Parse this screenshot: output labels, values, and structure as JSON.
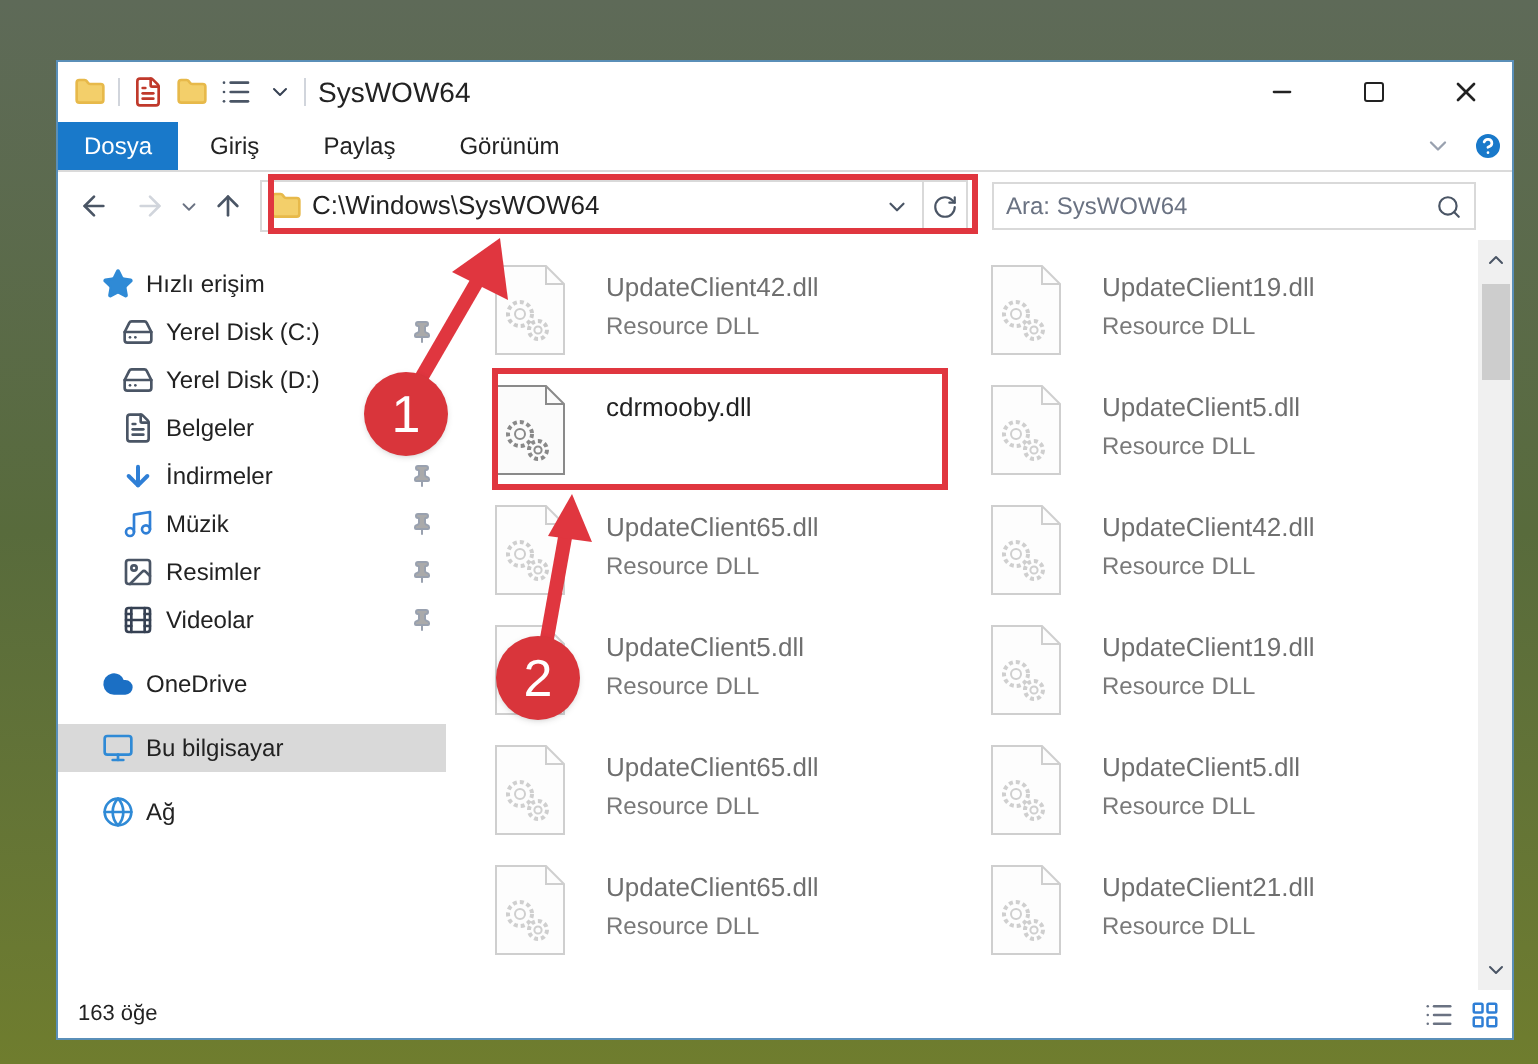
{
  "window": {
    "title": "SysWOW64"
  },
  "ribbon_tabs": [
    {
      "label": "Dosya",
      "selected": true
    },
    {
      "label": "Giriş",
      "selected": false
    },
    {
      "label": "Paylaş",
      "selected": false
    },
    {
      "label": "Görünüm",
      "selected": false
    }
  ],
  "address_bar": {
    "path": "C:\\Windows\\SysWOW64"
  },
  "search": {
    "placeholder": "Ara: SysWOW64"
  },
  "sidebar": {
    "items": [
      {
        "label": "Hızlı erişim",
        "selected": false,
        "children": [
          {
            "label": "Yerel Disk (C:)",
            "pinned": true
          },
          {
            "label": "Yerel Disk (D:)",
            "pinned": false
          },
          {
            "label": "Belgeler",
            "pinned": false
          },
          {
            "label": "İndirmeler",
            "pinned": true
          },
          {
            "label": "Müzik",
            "pinned": true
          },
          {
            "label": "Resimler",
            "pinned": true
          },
          {
            "label": "Videolar",
            "pinned": true
          }
        ]
      },
      {
        "label": "OneDrive",
        "selected": false
      },
      {
        "label": "Bu bilgisayar",
        "selected": true
      },
      {
        "label": "Ağ",
        "selected": false
      }
    ]
  },
  "files": [
    {
      "name": "UpdateClient42.dll",
      "type": "Resource DLL",
      "blurred": true
    },
    {
      "name": "UpdateClient19.dll",
      "type": "Resource DLL",
      "blurred": true
    },
    {
      "name": "cdrmooby.dll",
      "blurred": false
    },
    {
      "name": "UpdateClient5.dll",
      "type": "Resource DLL",
      "blurred": true
    },
    {
      "name": "UpdateClient65.dll",
      "type": "Resource DLL",
      "blurred": true
    },
    {
      "name": "UpdateClient42.dll",
      "type": "Resource DLL",
      "blurred": true
    },
    {
      "name": "UpdateClient5.dll",
      "type": "Resource DLL",
      "blurred": true
    },
    {
      "name": "UpdateClient19.dll",
      "type": "Resource DLL",
      "blurred": true
    },
    {
      "name": "UpdateClient65.dll",
      "type": "Resource DLL",
      "blurred": true
    },
    {
      "name": "UpdateClient5.dll",
      "type": "Resource DLL",
      "blurred": true
    },
    {
      "name": "UpdateClient65.dll",
      "type": "Resource DLL",
      "blurred": true
    },
    {
      "name": "UpdateClient21.dll",
      "type": "Resource DLL",
      "blurred": true
    }
  ],
  "status_bar": {
    "item_count": "163 öğe"
  },
  "annotations": [
    {
      "label": "1"
    },
    {
      "label": "2"
    }
  ]
}
